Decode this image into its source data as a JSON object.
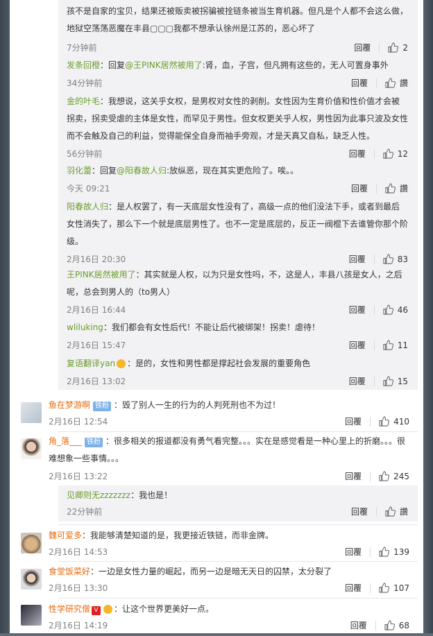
{
  "ui": {
    "reply": "回覆",
    "like_icon": "thumbs-up-icon",
    "zan": "讚"
  },
  "colors": {
    "username": "#e86b0f",
    "username_green": "#6b9c2a",
    "link": "#eb7350",
    "reply_bg": "#f2f2f5",
    "badge": "#7db1e8"
  },
  "replies": [
    {
      "user": "",
      "prefix": "",
      "text": "孩不是自家的宝贝，结果还被贩卖被拐骗被拴链条被当生育机器。但凡是个人都不会这么做，地狱空荡荡恶魔在丰县▢▢▢我都不想承认徐州是江苏的，恶心坏了",
      "time": "7分钟前",
      "likes": "2"
    },
    {
      "user": "发条回橙",
      "prefix": "：回复",
      "mention": "@王PINK居然被用了",
      "text": ":肾，血，子宫，但凡拥有这些的，无人可置身事外",
      "time": "34分钟前",
      "likes": "讚"
    },
    {
      "user": "金的叶毛",
      "prefix": "",
      "text": "：我想说，这关乎女权，是男权对女性的剥削。女性因为生育价值和性价值才会被拐卖，拐卖受虐的主体是女性，而罕见于男性。但女权更关乎人权，男性因为此事只波及女性而不会触及自己的利益，觉得能保全自身而袖手旁观，才是天真又自私，缺乏人性。",
      "time": "56分钟前",
      "likes": "12"
    },
    {
      "user": "羽化蕾",
      "prefix": "：回复",
      "mention": "@阳春故人归",
      "text": ":放纵恶，现在其实更危险了。唉。。",
      "time": "今天 09:21",
      "likes": "讚"
    },
    {
      "user": "阳春故人归",
      "prefix": "",
      "text": "：是人权罢了，有一天底层女性没有了，高级一点的他们没法下手，或者到最后女性消失了，那么下一个就是底层男性了。也不一定是底层的，反正一阀棍下去谁管你那个阶级。",
      "time": "2月16日 20:30",
      "likes": "83"
    },
    {
      "user": "王PINK居然被用了",
      "prefix": "",
      "text": "：其实就是人权，以为只是女性吗，不，这是人，丰县八孩是女人，之后呢，总会到男人的（to男人）",
      "time": "2月16日 16:44",
      "likes": "46"
    },
    {
      "user": "wliluking",
      "prefix": "",
      "text": "：我们都会有女性后代！不能让后代被绑架！拐卖！虐待！",
      "time": "2月16日 15:47",
      "likes": "11"
    },
    {
      "user": "复语翻译yan",
      "prefix": "",
      "text": "：是的，女性和男性都是撑起社会发展的重要角色",
      "time": "2月16日 13:02",
      "likes": "15"
    }
  ],
  "comments": [
    {
      "user": "鱼在梦游啊",
      "badge": "铁粉",
      "text": "：毁了别人一生的行为的人判死刑也不为过！",
      "time": "2月16日 12:54",
      "likes": "410"
    },
    {
      "user": "角_落___",
      "badge": "铁粉",
      "text": "：很多相关的报道都没有勇气看完整。。。实在是感觉看是一种心里上的折磨。。。很难想象一些事情。。。",
      "time": "2月16日 13:22",
      "likes": "245"
    },
    {
      "user": "见卿则无zzzzzzz",
      "text": "：我也是！",
      "time": "22分钟前",
      "likes": "讚"
    },
    {
      "user": "魏可爱多",
      "text": "：我能够清楚知道的是，我更接近铁链，而非金牌。",
      "time": "2月16日 14:53",
      "likes": "139"
    },
    {
      "user": "食堂饭菜好",
      "text": "：一边是女性力量的崛起，而另一边是暗无天日的囚禁，太分裂了",
      "time": "2月16日 13:30",
      "likes": "107"
    },
    {
      "user": "性学研究僧",
      "text": "：让这个世界更美好一点。",
      "time": "2月16日 14:19",
      "likes": "68"
    }
  ]
}
